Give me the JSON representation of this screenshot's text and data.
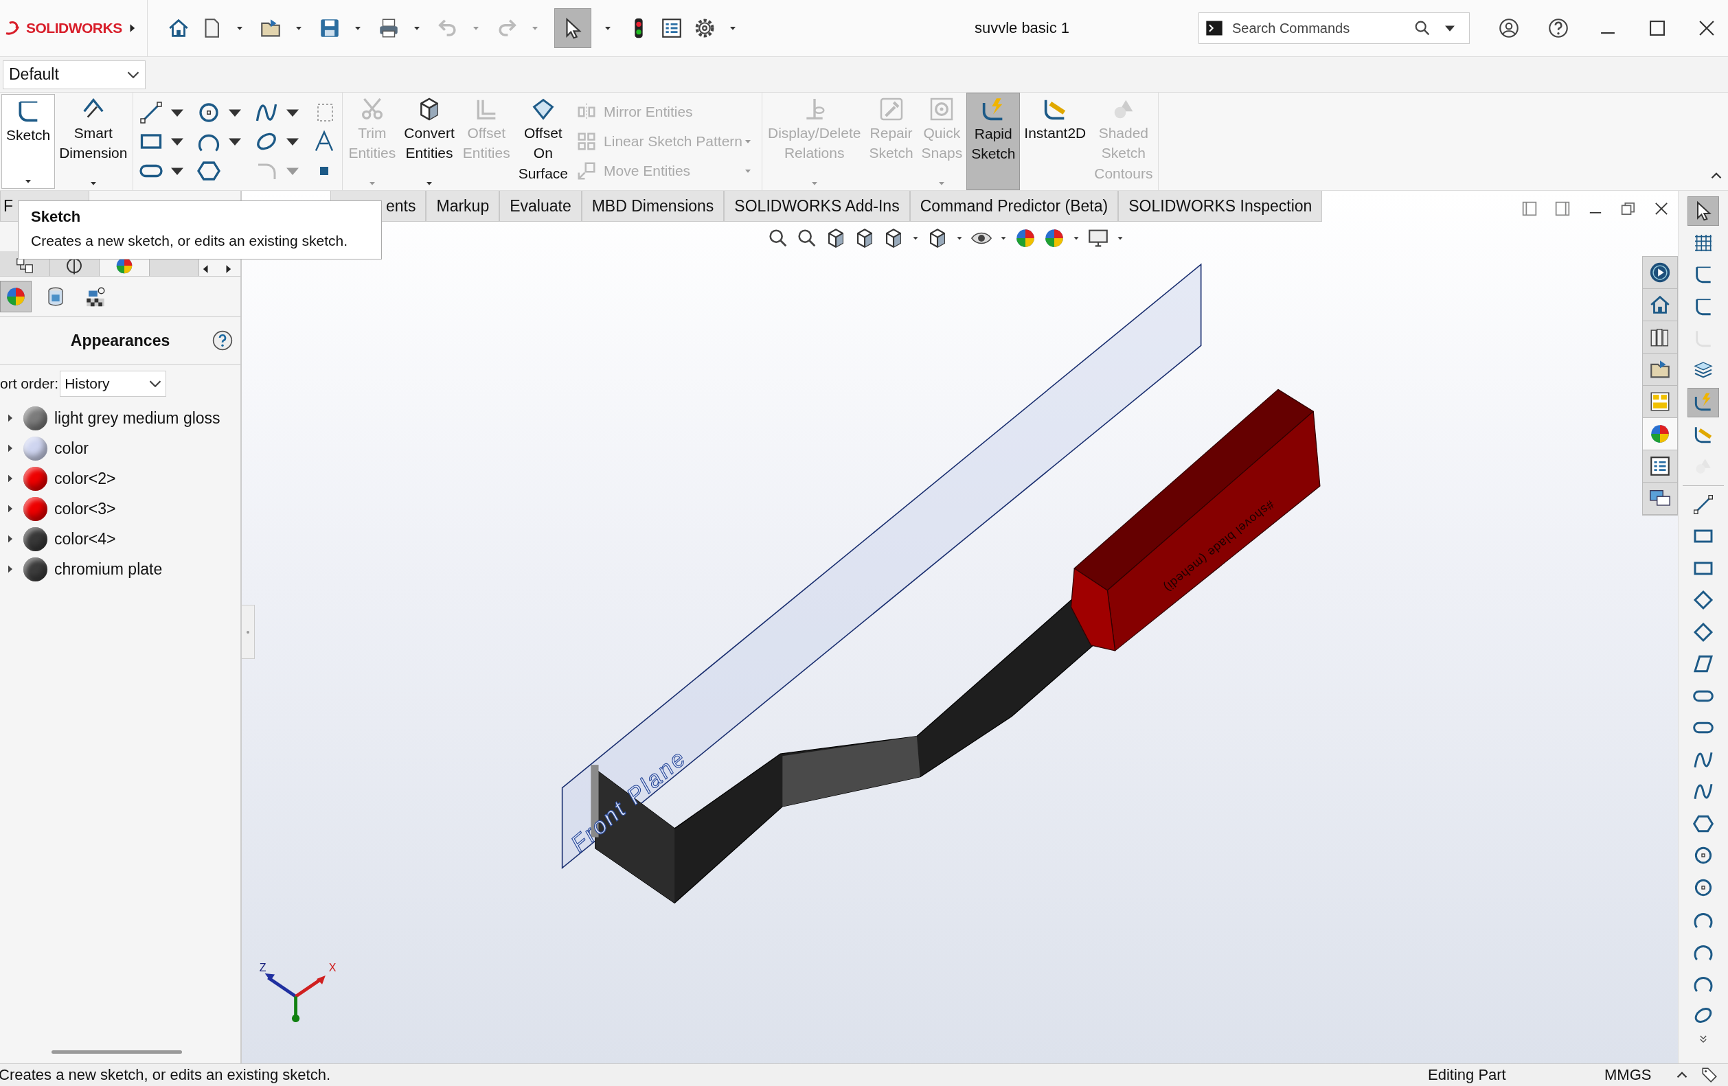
{
  "title_bar": {
    "logo": "SOLIDWORKS",
    "select_active": true,
    "document_title": "suvvle basic 1",
    "search": {
      "placeholder": "Search Commands"
    }
  },
  "configuration": {
    "value": "Default"
  },
  "ribbon": {
    "groups": [
      {
        "commands": [
          {
            "label": "Sketch",
            "kind": "large",
            "disabled": false,
            "selected": false,
            "dropdown": true
          },
          {
            "label": "Smart Dimension",
            "kind": "large",
            "disabled": false,
            "selected": false,
            "dropdown": true
          }
        ]
      },
      {
        "commands": [
          {
            "label": "Trim Entities",
            "kind": "large",
            "disabled": true,
            "selected": false,
            "dropdown": true
          },
          {
            "label": "Convert Entities",
            "kind": "large",
            "disabled": false,
            "selected": false,
            "dropdown": true
          },
          {
            "label": "Offset Entities",
            "kind": "large",
            "disabled": true,
            "selected": false,
            "dropdown": false
          },
          {
            "label": "Offset On Surface",
            "kind": "large",
            "disabled": false,
            "selected": false,
            "dropdown": false
          },
          {
            "label": "Mirror Entities",
            "kind": "row",
            "disabled": true,
            "selected": false,
            "dropdown": false
          },
          {
            "label": "Linear Sketch Pattern",
            "kind": "row",
            "disabled": true,
            "selected": false,
            "dropdown": true
          },
          {
            "label": "Move Entities",
            "kind": "row",
            "disabled": true,
            "selected": false,
            "dropdown": true
          }
        ]
      },
      {
        "commands": [
          {
            "label": "Display/Delete Relations",
            "kind": "large",
            "disabled": true,
            "selected": false,
            "dropdown": true
          },
          {
            "label": "Repair Sketch",
            "kind": "large",
            "disabled": true,
            "selected": false,
            "dropdown": false
          },
          {
            "label": "Quick Snaps",
            "kind": "large",
            "disabled": true,
            "selected": false,
            "dropdown": true
          },
          {
            "label": "Rapid Sketch",
            "kind": "large",
            "disabled": false,
            "selected": true,
            "dropdown": false
          },
          {
            "label": "Instant2D",
            "kind": "large",
            "disabled": false,
            "selected": false,
            "dropdown": false
          },
          {
            "label": "Shaded Sketch Contours",
            "kind": "large",
            "disabled": true,
            "selected": false,
            "dropdown": false
          }
        ]
      }
    ]
  },
  "tabs": [
    {
      "label": "F",
      "selected": false
    },
    {
      "label": "ents",
      "selected": false
    },
    {
      "label": "Markup",
      "selected": false
    },
    {
      "label": "Evaluate",
      "selected": false
    },
    {
      "label": "MBD Dimensions",
      "selected": false
    },
    {
      "label": "SOLIDWORKS Add-Ins",
      "selected": false
    },
    {
      "label": "Command Predictor (Beta)",
      "selected": false
    },
    {
      "label": "SOLIDWORKS Inspection",
      "selected": false
    }
  ],
  "tooltip": {
    "title": "Sketch",
    "text": "Creates a new sketch, or edits an existing sketch."
  },
  "panel": {
    "tabs": [
      {
        "selected": false
      },
      {
        "selected": false
      },
      {
        "selected": true
      },
      {
        "selected": false
      }
    ],
    "view_buttons": [
      {
        "selected": true
      },
      {
        "selected": false
      },
      {
        "selected": false
      }
    ],
    "title": "Appearances",
    "sort_label": "ort order:",
    "sort_value": "History",
    "items": [
      {
        "label": "light grey medium gloss",
        "color": "#7c7c7c",
        "expanded": false
      },
      {
        "label": "color",
        "color": "#cfd5f0",
        "expanded": false
      },
      {
        "label": "color<2>",
        "color": "#ee0000",
        "expanded": false
      },
      {
        "label": "color<3>",
        "color": "#ee0000",
        "expanded": false
      },
      {
        "label": "color<4>",
        "color": "#383838",
        "expanded": false
      },
      {
        "label": "chromium plate",
        "color": "#3c3c3c",
        "expanded": false
      }
    ]
  },
  "viewport": {
    "plane_label": "Front Plane",
    "engraving": "#shovel blade (mehedi)",
    "axis_z": "Z",
    "axis_x": "X"
  },
  "task_pane": [
    {
      "selected": false
    },
    {
      "selected": false
    },
    {
      "selected": false
    },
    {
      "selected": false
    },
    {
      "selected": false
    },
    {
      "selected": true
    },
    {
      "selected": false
    },
    {
      "selected": false
    }
  ],
  "sketch_toolbar": [
    {
      "selected": true,
      "disabled": false
    },
    {
      "selected": false,
      "disabled": false
    },
    {
      "selected": false,
      "disabled": false
    },
    {
      "selected": false,
      "disabled": false
    },
    {
      "selected": false,
      "disabled": true
    },
    {
      "selected": false,
      "disabled": false
    },
    {
      "selected": true,
      "disabled": false
    },
    {
      "selected": false,
      "disabled": false
    },
    {
      "selected": false,
      "disabled": true
    },
    {
      "selected": false,
      "disabled": false
    },
    {
      "selected": false,
      "disabled": false
    },
    {
      "selected": false,
      "disabled": false
    },
    {
      "selected": false,
      "disabled": false
    },
    {
      "selected": false,
      "disabled": false
    },
    {
      "selected": false,
      "disabled": false
    },
    {
      "selected": false,
      "disabled": false
    },
    {
      "selected": false,
      "disabled": false
    },
    {
      "selected": false,
      "disabled": false
    },
    {
      "selected": false,
      "disabled": false
    },
    {
      "selected": false,
      "disabled": false
    },
    {
      "selected": false,
      "disabled": false
    },
    {
      "selected": false,
      "disabled": false
    },
    {
      "selected": false,
      "disabled": false
    },
    {
      "selected": false,
      "disabled": false
    },
    {
      "selected": false,
      "disabled": false
    },
    {
      "selected": false,
      "disabled": false
    }
  ],
  "status_bar": {
    "message": "Creates a new sketch, or edits an existing sketch.",
    "mode": "Editing Part",
    "units": "MMGS"
  }
}
